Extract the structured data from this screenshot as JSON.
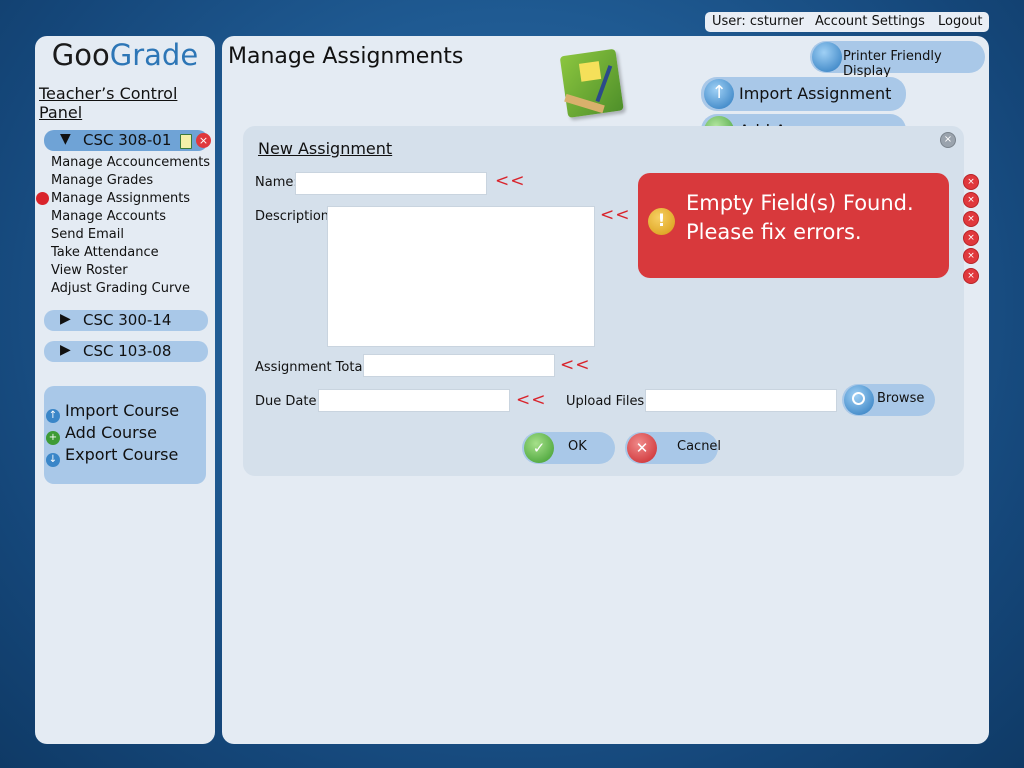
{
  "userbar": {
    "user": "User: csturner",
    "account_settings": "Account Settings",
    "logout": "Logout"
  },
  "sidebar": {
    "logo_part1": "Goo",
    "logo_part2": "Grade",
    "title": "Teacher’s Control Panel",
    "active_course": "CSC 308-01",
    "links": [
      "Manage Accouncements",
      "Manage Grades",
      "Manage Assignments",
      "Manage Accounts",
      "Send Email",
      "Take Attendance",
      "View Roster",
      "Adjust Grading Curve"
    ],
    "selected_link": "Manage Assignments",
    "courses": [
      "CSC 300-14",
      "CSC 103-08"
    ],
    "expand_arrow": "▼",
    "collapse_arrow": "▶",
    "course_actions": [
      "Import Course",
      "Add Course",
      "Export Course"
    ]
  },
  "main": {
    "title": "Manage Assignments",
    "printer_friendly": "Printer Friendly Display",
    "import_assignment": "Import Assignment",
    "add_assignment_partial": "Add As..."
  },
  "dialog": {
    "title": "New Assignment",
    "name_label": "Name:",
    "description_label": "Description:",
    "total_label": "Assignment Total:",
    "due_label": "Due Date:",
    "upload_label": "Upload Files:",
    "error_marker": "<<",
    "browse": "Browse",
    "ok": "OK",
    "cancel": "Cacnel"
  },
  "error": {
    "line1": "Empty Field(s) Found.",
    "line2": "Please fix errors."
  },
  "colors": {
    "background": "#1f5a92",
    "panel": "#e4ebf3",
    "pill": "#a9c8e8",
    "error": "#d8393c"
  },
  "icons": {
    "course_note": "notepad-icon",
    "course_delete": "delete-icon",
    "printer": "printer-icon",
    "import": "upload-arrow-icon",
    "search": "magnifier-icon",
    "ok": "checkmark-icon",
    "cancel": "x-icon",
    "warning": "exclamation-icon"
  }
}
